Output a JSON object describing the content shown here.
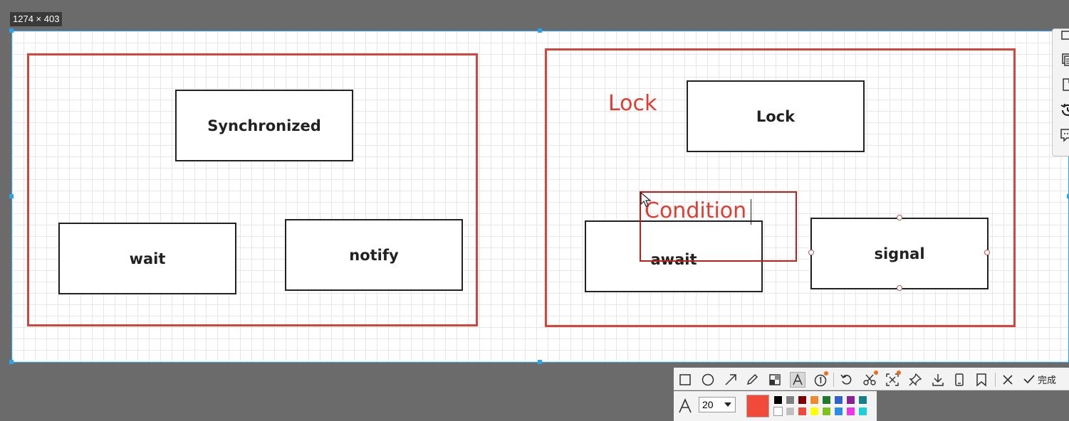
{
  "capture": {
    "size_label": "1274 × 403"
  },
  "diagram": {
    "left": {
      "title_box": "Synchronized",
      "box_a": "wait",
      "box_b": "notify"
    },
    "right": {
      "title_box": "Lock",
      "box_a": "await",
      "box_b": "signal",
      "annotation_lock": "Lock",
      "annotation_condition": "Condition"
    }
  },
  "toolbar": {
    "done_label": "完成",
    "font_size": "20",
    "current_color": "#f24a3a",
    "palette": [
      "#000000",
      "#808080",
      "#800000",
      "#f0882e",
      "#1e7b2e",
      "#3162d0",
      "#8a1f98",
      "#13818a",
      "#ffffff",
      "#c0c0c0",
      "#f24a3a",
      "#ffff00",
      "#7ec21a",
      "#2b8ee6",
      "#ee35e9",
      "#1ad0da"
    ]
  },
  "icons": {
    "side": [
      "crop-icon",
      "copy-icon",
      "file-icon",
      "history-icon",
      "comment-icon"
    ],
    "tools": [
      "rectangle-icon",
      "ellipse-icon",
      "arrow-icon",
      "pencil-icon",
      "mosaic-icon",
      "text-icon",
      "number-icon",
      "undo-icon",
      "cut-icon",
      "ocr-icon",
      "pin-icon",
      "download-icon",
      "phone-icon",
      "bookmark-icon",
      "close-icon",
      "check-icon"
    ]
  }
}
